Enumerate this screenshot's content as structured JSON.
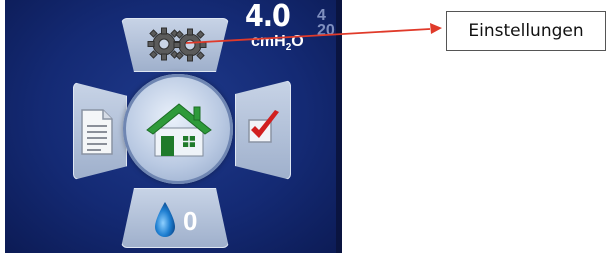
{
  "screen": {
    "pressure_value": "4.0",
    "pressure_unit_main": "cmH",
    "pressure_unit_sub": "2",
    "pressure_unit_tail": "O",
    "side_value_top": "4",
    "side_value_bottom": "20",
    "water_count": "0"
  },
  "menu": {
    "top_icon": "gears-icon",
    "left_icon": "document-icon",
    "center_icon": "home-icon",
    "right_icon": "checkmark-icon",
    "bottom_icon": "water-drop-icon"
  },
  "callout": {
    "label": "Einstellungen"
  },
  "colors": {
    "screen_bg": "#142a74",
    "tile": "#b3c2da",
    "arrow": "#e03a2a",
    "home_roof": "#2e9a3a",
    "check": "#d11f1f",
    "drop": "#1f7fd1"
  }
}
